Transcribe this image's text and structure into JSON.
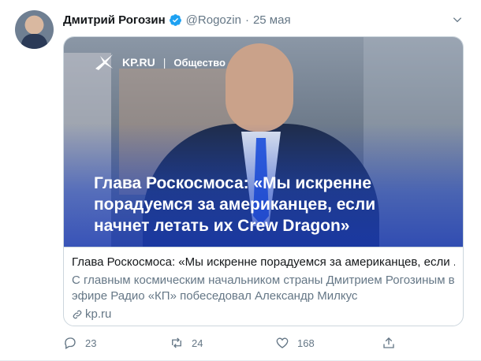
{
  "tweet": {
    "author_name": "Дмитрий Рогозин",
    "handle": "@Rogozin",
    "separator": "·",
    "date": "25 мая"
  },
  "card": {
    "brand": "KP.RU",
    "brand_separator": "|",
    "section": "Общество",
    "headline_lines": [
      "Глава Роскосмоса: «Мы искренне",
      "порадуемся за американцев, если",
      "начнет летать их Crew Dragon»"
    ],
    "title": "Глава Роскосмоса: «Мы искренне порадуемся за американцев, если ...",
    "description": "С главным космическим начальником страны Дмитрием Рогозиным в эфире Радио «КП» побеседовал Александр Милкус",
    "domain": "kp.ru"
  },
  "actions": {
    "replies": "23",
    "retweets": "24",
    "likes": "168"
  },
  "icons": {
    "verified": "verified-badge-icon",
    "caret": "chevron-down-icon",
    "reply": "reply-icon",
    "retweet": "retweet-icon",
    "like": "heart-icon",
    "share": "share-icon",
    "link": "link-icon"
  },
  "colors": {
    "verified_blue": "#1da1f2",
    "secondary_text": "#657786",
    "border": "#ccd6dd"
  }
}
